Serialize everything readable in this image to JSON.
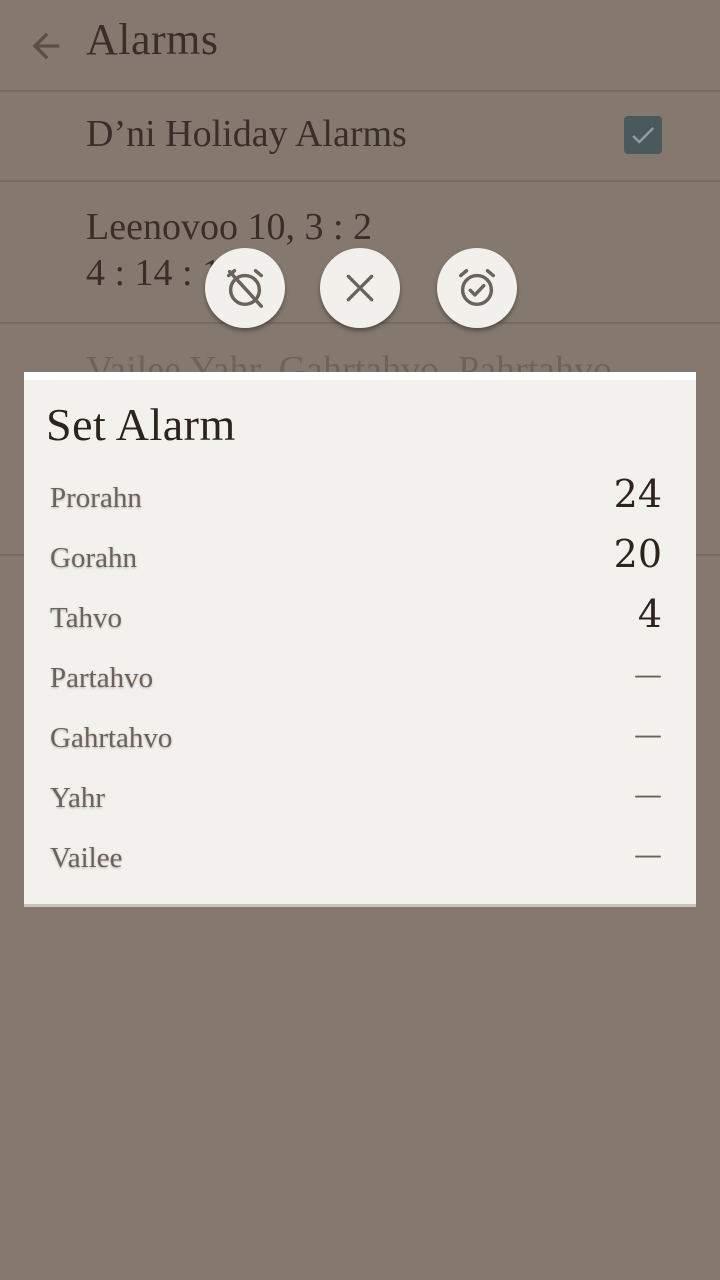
{
  "app": {
    "title": "Alarms"
  },
  "list": {
    "holiday_row": {
      "label": "D’ni Holiday Alarms",
      "checked": true
    },
    "alarm_row": {
      "label": "Leenovoo 10, 3 : 2\n4 : 14 : 12"
    },
    "partial_row": {
      "label": "Vailee Yahr, Gahrtahvo, Pahrtahvo"
    }
  },
  "fab": {
    "clear_icon": "alarm-off-icon",
    "cancel_icon": "close-icon",
    "set_icon": "alarm-check-icon"
  },
  "dialog": {
    "title": "Set Alarm",
    "fields": [
      {
        "label": "Prorahn",
        "value": "24"
      },
      {
        "label": "Gorahn",
        "value": "20"
      },
      {
        "label": "Tahvo",
        "value": "4"
      },
      {
        "label": "Partahvo",
        "value": "—"
      },
      {
        "label": "Gahrtahvo",
        "value": "—"
      },
      {
        "label": "Yahr",
        "value": "—"
      },
      {
        "label": "Vailee",
        "value": "—"
      }
    ]
  },
  "colors": {
    "scrim": "#85796f",
    "dialog_bg": "#f2f1ed",
    "checkbox": "#4a5a5c",
    "text_dark": "#2c231e",
    "text_muted": "#6d6259"
  }
}
